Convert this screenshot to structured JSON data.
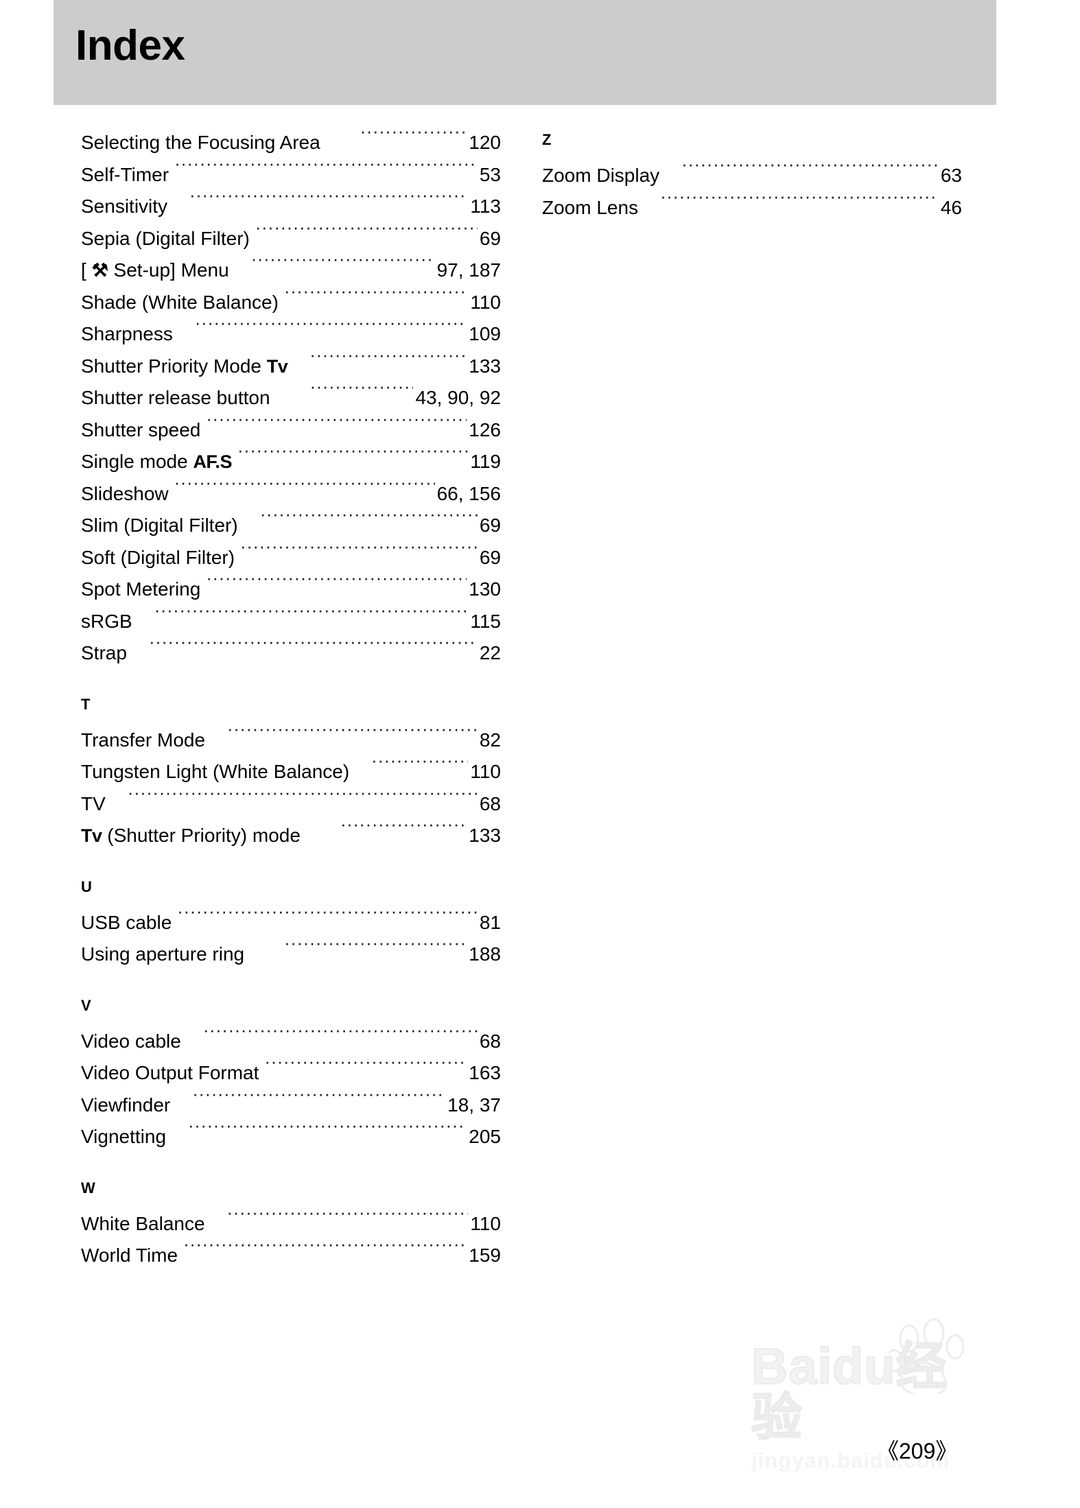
{
  "header": {
    "title": "Index"
  },
  "left_column": {
    "blocks": [
      {
        "letter": "",
        "entries": [
          {
            "label": "Selecting the Focusing Area",
            "page": "120",
            "gap": "gap-md"
          },
          {
            "label": "Self-Timer",
            "page": "53",
            "gap": ""
          },
          {
            "label": "Sensitivity",
            "page": "113",
            "gap": "gap-sm"
          },
          {
            "label": "Sepia (Digital Filter)",
            "page": "69",
            "gap": ""
          },
          {
            "label": "[ Set-up] Menu",
            "page": "97, 187",
            "gap": "gap-sm",
            "symbol": "wrench-hammer-icon"
          },
          {
            "label": "Shade (White Balance)",
            "page": "110",
            "gap": ""
          },
          {
            "label": "Sharpness",
            "page": "109",
            "gap": "gap-sm"
          },
          {
            "label": "Shutter Priority Mode",
            "page": "133",
            "gap": "gap-sm",
            "symbol": "Tv"
          },
          {
            "label": "Shutter release button",
            "page": "43, 90, 92",
            "gap": "gap-md"
          },
          {
            "label": "Shutter speed",
            "page": "126",
            "gap": ""
          },
          {
            "label": "Single mode",
            "page": "119",
            "gap": "",
            "symbol": "AF.S"
          },
          {
            "label": "Slideshow",
            "page": "66, 156",
            "gap": ""
          },
          {
            "label": "Slim (Digital Filter)",
            "page": "69",
            "gap": "gap-sm"
          },
          {
            "label": "Soft (Digital Filter)",
            "page": "69",
            "gap": ""
          },
          {
            "label": "Spot Metering",
            "page": "130",
            "gap": ""
          },
          {
            "label": "sRGB",
            "page": "115",
            "gap": "gap-sm"
          },
          {
            "label": "Strap",
            "page": "22",
            "gap": "gap-sm"
          }
        ]
      },
      {
        "letter": "T",
        "entries": [
          {
            "label": "Transfer Mode",
            "page": "82",
            "gap": "gap-sm"
          },
          {
            "label": "Tungsten Light (White Balance)",
            "page": "110",
            "gap": "gap-sm"
          },
          {
            "label": "TV",
            "page": "68",
            "gap": "gap-sm"
          },
          {
            "label": "(Shutter Priority) mode",
            "page": "133",
            "gap": "gap-md",
            "symbol": "Tv",
            "symbol_first": true
          }
        ]
      },
      {
        "letter": "U",
        "entries": [
          {
            "label": "USB cable",
            "page": "81",
            "gap": ""
          },
          {
            "label": "Using aperture ring",
            "page": "188",
            "gap": "gap-md"
          }
        ]
      },
      {
        "letter": "V",
        "entries": [
          {
            "label": "Video cable",
            "page": "68",
            "gap": "gap-sm"
          },
          {
            "label": "Video Output Format",
            "page": "163",
            "gap": ""
          },
          {
            "label": "Viewfinder",
            "page": "18, 37",
            "gap": "gap-sm"
          },
          {
            "label": "Vignetting",
            "page": "205",
            "gap": "gap-sm"
          }
        ]
      },
      {
        "letter": "W",
        "entries": [
          {
            "label": "White Balance",
            "page": "110",
            "gap": "gap-sm"
          },
          {
            "label": "World Time",
            "page": "159",
            "gap": ""
          }
        ]
      }
    ]
  },
  "right_column": {
    "blocks": [
      {
        "letter": "Z",
        "entries": [
          {
            "label": "Zoom Display",
            "page": "63",
            "gap": "gap-sm"
          },
          {
            "label": "Zoom Lens",
            "page": "46",
            "gap": "gap-sm"
          }
        ]
      }
    ]
  },
  "watermark": {
    "brand": "Baidu",
    "brand_cn": "经验",
    "site": "jingyan.baidu.com"
  },
  "footer": {
    "page_number": "《209》"
  }
}
